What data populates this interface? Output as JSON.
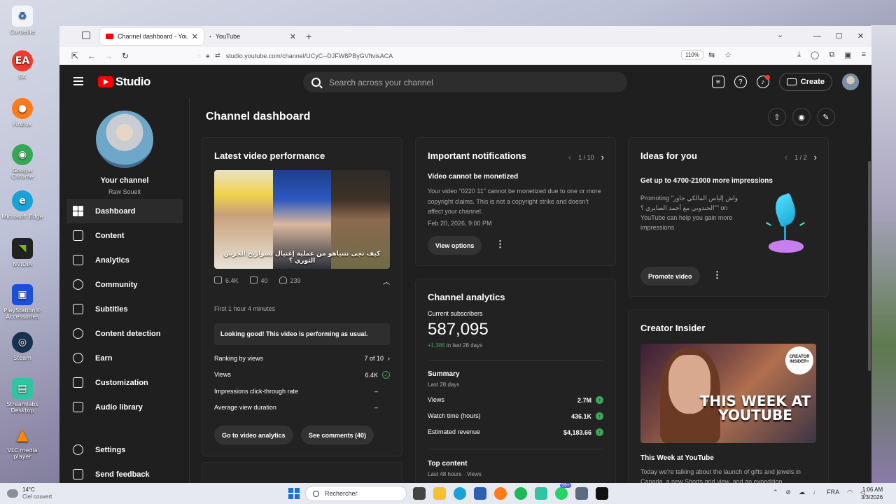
{
  "desktop": {
    "icons": [
      {
        "label": "Corbeille",
        "icon": "recycle-bin-icon",
        "color": "#f2f4f7"
      },
      {
        "label": "EA",
        "icon": "ea-icon",
        "color": "#ef3b2c"
      },
      {
        "label": "Firefox",
        "icon": "firefox-icon",
        "color": "#ff7a18"
      },
      {
        "label": "Google Chrome",
        "icon": "chrome-icon",
        "color": "#34a853"
      },
      {
        "label": "Microsoft Edge",
        "icon": "edge-icon",
        "color": "#1aa1d6"
      },
      {
        "label": "NVIDIA",
        "icon": "nvidia-icon",
        "color": "#76b900"
      },
      {
        "label": "PlayStation® Accessories",
        "icon": "playstation-icon",
        "color": "#1b4fd6"
      },
      {
        "label": "Steam",
        "icon": "steam-icon",
        "color": "#16324e"
      },
      {
        "label": "Streamlabs Desktop",
        "icon": "streamlabs-icon",
        "color": "#31c3a2"
      },
      {
        "label": "VLC media player",
        "icon": "vlc-icon",
        "color": "#ff8800"
      }
    ]
  },
  "browser": {
    "tabs": [
      {
        "title": "Channel dashboard - YouTube S",
        "active": true
      },
      {
        "title": "YouTube",
        "active": false
      }
    ],
    "url": "studio.youtube.com/channel/UCyC--DJFW8PByGVftvisACA",
    "zoom": "110%"
  },
  "studio": {
    "logo_text": "Studio",
    "search_placeholder": "Search across your channel",
    "create_label": "Create"
  },
  "sidebar": {
    "channel_name": "Your channel",
    "channel_handle": "Raw Soueit",
    "items": [
      {
        "label": "Dashboard",
        "icon": "dashboard-icon",
        "active": true
      },
      {
        "label": "Content",
        "icon": "content-icon"
      },
      {
        "label": "Analytics",
        "icon": "analytics-icon"
      },
      {
        "label": "Community",
        "icon": "community-icon"
      },
      {
        "label": "Subtitles",
        "icon": "subtitles-icon"
      },
      {
        "label": "Content detection",
        "icon": "copyright-icon"
      },
      {
        "label": "Earn",
        "icon": "earn-icon"
      },
      {
        "label": "Customization",
        "icon": "customization-icon"
      },
      {
        "label": "Audio library",
        "icon": "audio-library-icon"
      }
    ],
    "bottom_items": [
      {
        "label": "Settings",
        "icon": "settings-icon"
      },
      {
        "label": "Send feedback",
        "icon": "feedback-icon"
      }
    ]
  },
  "main": {
    "page_title": "Channel dashboard",
    "latest_video": {
      "title": "Latest video performance",
      "thumb_caption": "كيف نجى نتنياهو من عملية إغتيال بصواريخ الحرس الثوري ؟",
      "views": "6.4K",
      "comments": "40",
      "likes": "239",
      "first_hour": "First 1 hour 4 minutes",
      "status_message": "Looking good! This video is performing as usual.",
      "metrics": [
        {
          "label": "Ranking by views",
          "value": "7 of 10"
        },
        {
          "label": "Views",
          "value": "6.4K"
        },
        {
          "label": "Impressions click-through rate",
          "value": "–"
        },
        {
          "label": "Average view duration",
          "value": "–"
        }
      ],
      "btn_analytics": "Go to video analytics",
      "btn_comments": "See comments (40)"
    },
    "notifications": {
      "title": "Important notifications",
      "pager": "1 / 10",
      "item_title": "Video cannot be monetized",
      "item_body": "Your video \"0220 11\" cannot be monetized due to one or more copyright claims. This is not a copyright strike and doesn't affect your channel.",
      "item_date": "Feb 20, 2026, 9:00 PM",
      "btn": "View options"
    },
    "analytics": {
      "title": "Channel analytics",
      "subs_label": "Current subscribers",
      "subs_value": "587,095",
      "subs_delta": "+1,386",
      "subs_delta_suffix": " in last 28 days",
      "summary_title": "Summary",
      "summary_sub": "Last 28 days",
      "rows": [
        {
          "label": "Views",
          "value": "2.7M"
        },
        {
          "label": "Watch time (hours)",
          "value": "436.1K"
        },
        {
          "label": "Estimated revenue",
          "value": "$4,183.66"
        }
      ],
      "top_content": "Top content",
      "top_content_sub": "Last 48 hours · Views"
    },
    "ideas": {
      "title": "Ideas for you",
      "pager": "1 / 2",
      "headline": "Get up to 4700-21000 more impressions",
      "body": "Promoting \"واش إلياس المالكي جاوز \"الجندوبي مع أحمد الصايري ؟\" on YouTube can help you gain more impressions",
      "btn": "Promote video"
    },
    "creator_insider": {
      "title": "Creator Insider",
      "badge": "CREATOR INSIDER+",
      "overlay": "THIS WEEK AT YOUTUBE",
      "caption": "This Week at YouTube",
      "desc": "Today we're talking about the launch of gifts and jewels in Canada, a new Shorts grid view, and an expedition..."
    }
  },
  "taskbar": {
    "temp": "14°C",
    "weather": "Ciel couvert",
    "search": "Rechercher",
    "badge": "99+",
    "lang": "FRA",
    "time": "1:06 AM",
    "date": "3/3/2026"
  }
}
